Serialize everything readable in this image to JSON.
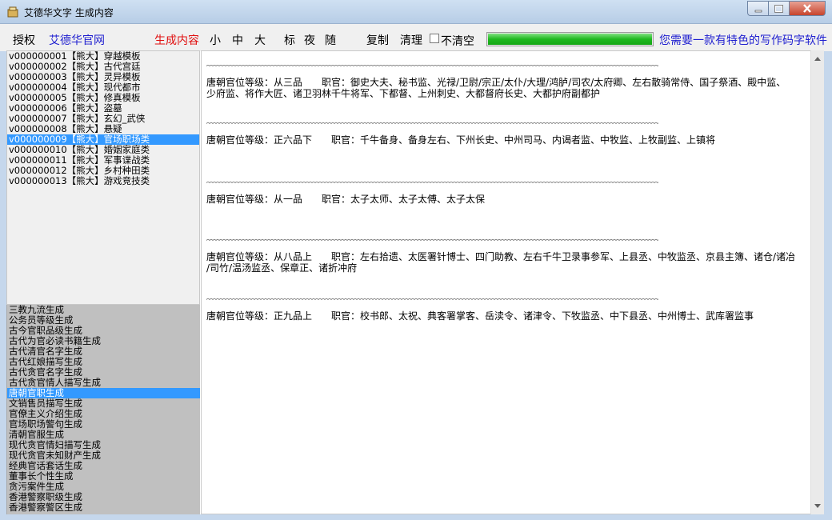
{
  "window": {
    "title": "艾德华文字 生成内容"
  },
  "toolbar": {
    "auth": "授权",
    "site": "艾德华官网",
    "generate": "生成内容",
    "small": "小",
    "medium": "中",
    "large": "大",
    "standard": "标",
    "night": "夜",
    "random": "随",
    "copy": "复制",
    "clear": "清理",
    "noclear": "不清空",
    "progress_percent": 100,
    "slogan": "您需要一款有特色的写作码字软件"
  },
  "templates": [
    "v000000001【熊大】穿越模板",
    "v000000002【熊大】古代宫廷",
    "v000000003【熊大】灵异模板",
    "v000000004【熊大】现代都市",
    "v000000005【熊大】修真模板",
    "v000000006【熊大】盗墓",
    "v000000007【熊大】玄幻_武侠",
    "v000000008【熊大】悬疑",
    "v000000009【熊大】官场职场类",
    "v000000010【熊大】婚姻家庭类",
    "v000000011【熊大】军事谍战类",
    "v000000012【熊大】乡村种田类",
    "v000000013【熊大】游戏竞技类"
  ],
  "selected_template": 8,
  "generators": [
    "三教九流生成",
    "公务员等级生成",
    "古今官职品级生成",
    "古代为官必读书籍生成",
    "古代清官名字生成",
    "古代红娘描写生成",
    "古代贪官名字生成",
    "古代贪官情人描写生成",
    "唐朝官职生成",
    "文销售员描写生成",
    "官僚主义介绍生成",
    "官场职场警句生成",
    "清朝官服生成",
    "现代贪官情妇描写生成",
    "现代贪官未知财产生成",
    "经典官话套话生成",
    "董事长个性生成",
    "贪污案件生成",
    "香港警察职级生成",
    "香港警察警区生成"
  ],
  "selected_generator": 8,
  "entries": [
    {
      "lines": [
        "唐朝官位等级：从三品　　职官：御史大夫、秘书监、光禄/卫尉/宗正/太仆/大理/鸿胪/司农/太府卿、左右散骑常侍、国子祭酒、殿中监、",
        "少府监、将作大匠、诸卫羽林千牛将军、下都督、上州刺史、大都督府长史、大都护府副都护"
      ]
    },
    {
      "lines": [
        "唐朝官位等级：正六品下　　职官：千牛备身、备身左右、下州长史、中州司马、内谒者监、中牧监、上牧副监、上镇将"
      ]
    },
    {
      "lines": [
        "唐朝官位等级：从一品　　职官：太子太师、太子太傅、太子太保"
      ]
    },
    {
      "lines": [
        "唐朝官位等级：从八品上　　职官：左右拾遗、太医署针博士、四门助教、左右千牛卫录事参军、上县丞、中牧监丞、京县主簿、诸仓/诸冶",
        "/司竹/温汤监丞、保章正、诸折冲府"
      ]
    },
    {
      "lines": [
        "唐朝官位等级：正九品上　　职官：校书郎、太祝、典客署掌客、岳渎令、诸津令、下牧监丞、中下县丞、中州博士、武库署监事"
      ]
    }
  ]
}
